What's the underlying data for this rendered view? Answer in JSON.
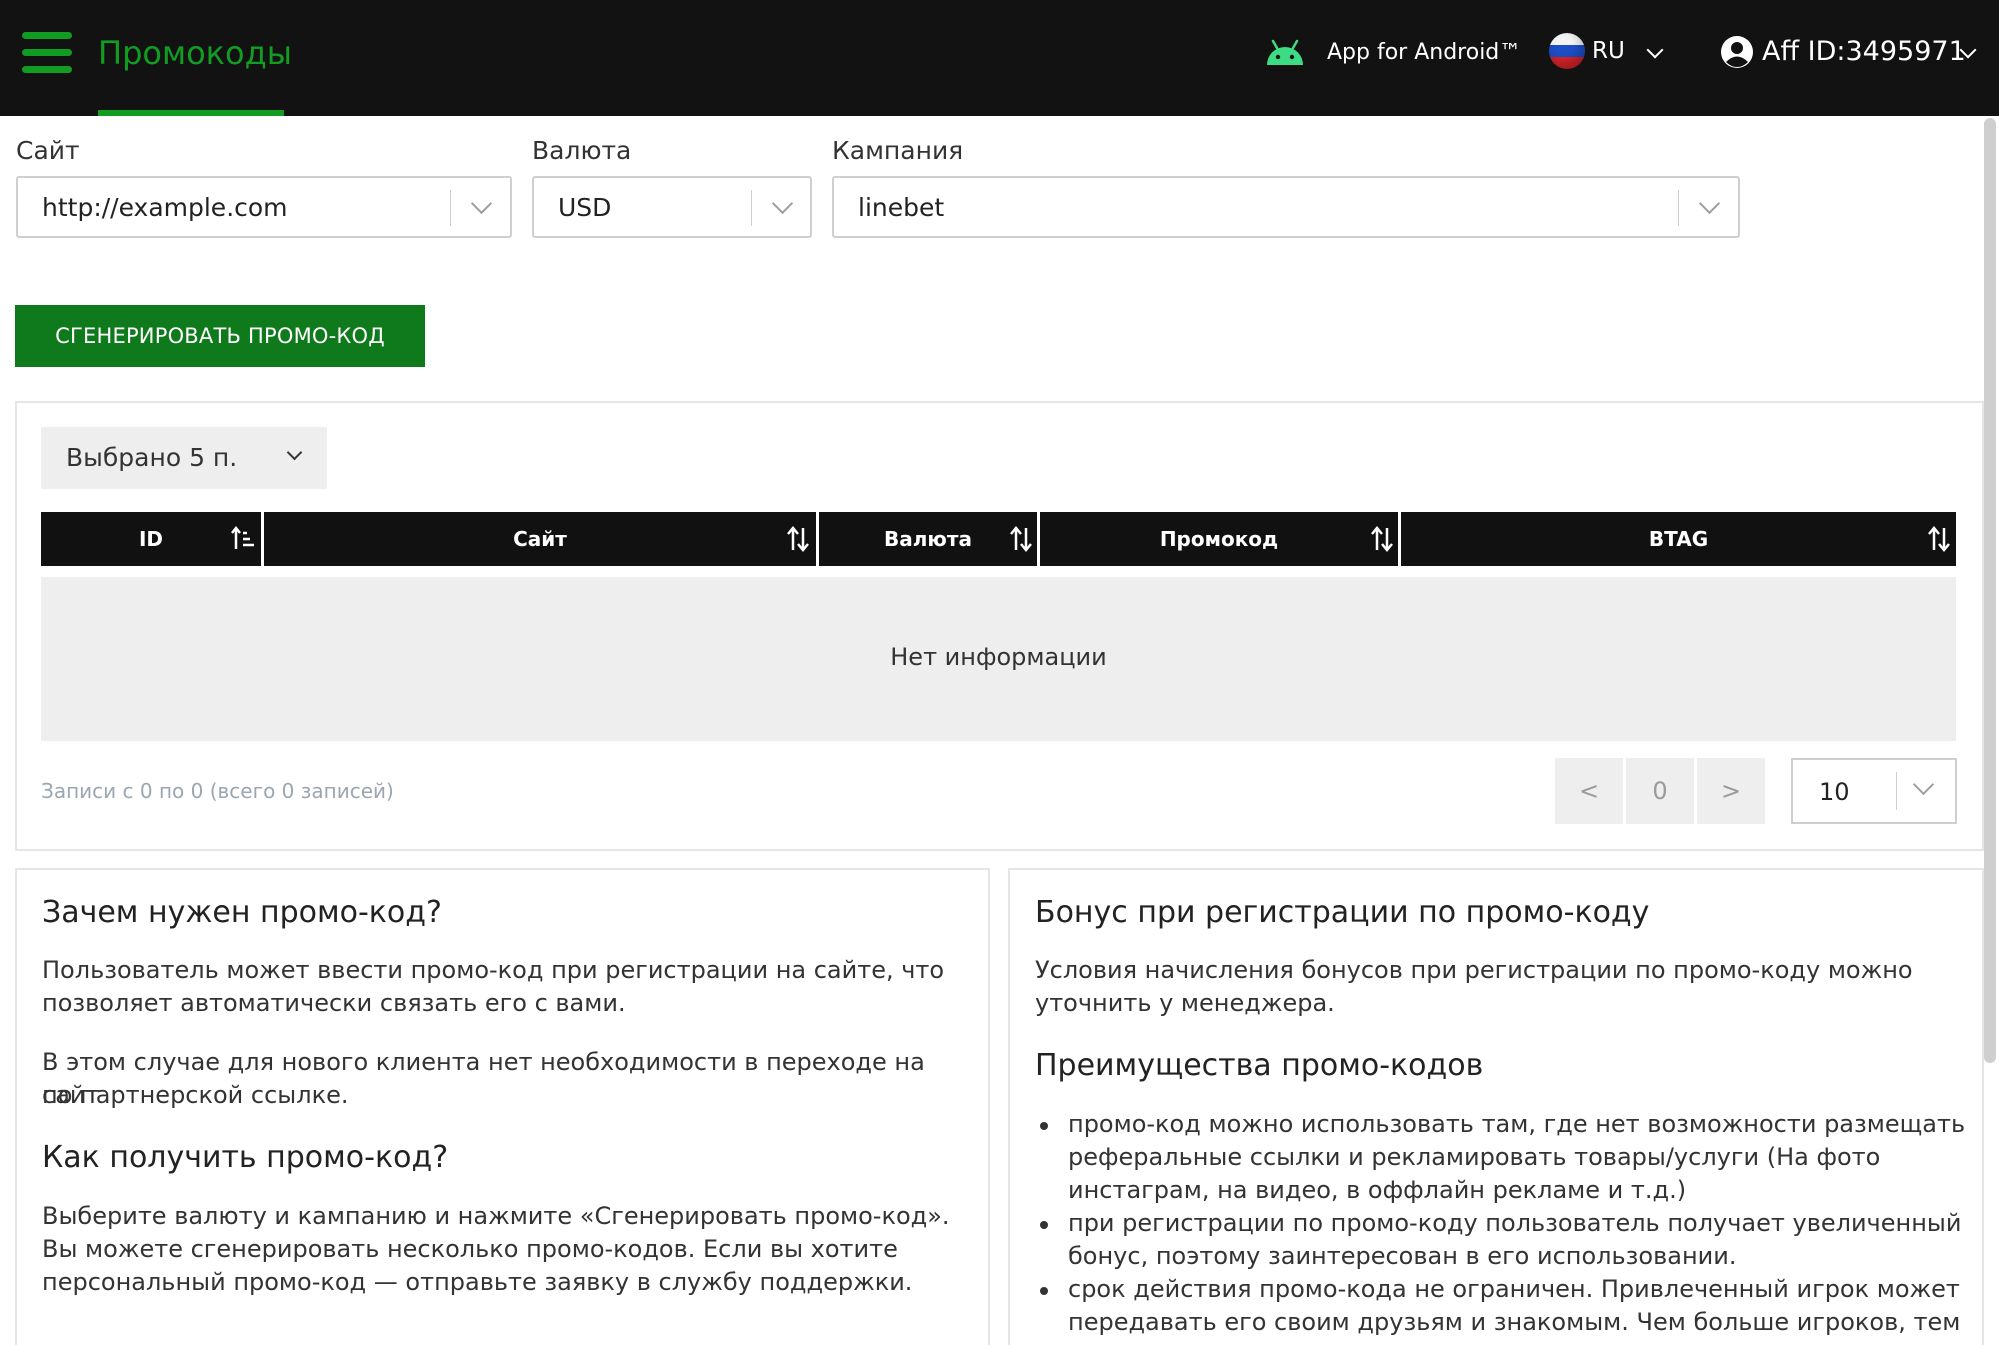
{
  "header": {
    "title": "Промокоды",
    "app_label": "App for Android™",
    "language": "RU",
    "aff_id": "Aff ID:3495971"
  },
  "filters": {
    "site": {
      "label": "Сайт",
      "value": "http://example.com"
    },
    "currency": {
      "label": "Валюта",
      "value": "USD"
    },
    "campaign": {
      "label": "Кампания",
      "value": "linebet"
    }
  },
  "generate_button": "СГЕНЕРИРОВАТЬ ПРОМО-КОД",
  "table": {
    "selected_columns": "Выбрано 5 п.",
    "columns": [
      "ID",
      "Сайт",
      "Валюта",
      "Промокод",
      "BTAG"
    ],
    "empty_text": "Нет информации",
    "records_text": "Записи с 0 по 0 (всего 0 записей)",
    "pagination": {
      "prev": "<",
      "page": "0",
      "next": ">"
    },
    "per_page": "10"
  },
  "info_left": {
    "heading1": "Зачем нужен промо-код?",
    "para1_line1": "Пользователь может ввести промо-код при регистрации на сайте, что",
    "para1_line2": "позволяет автоматически связать его с вами.",
    "para2_line1": "В этом случае для нового клиента нет необходимости в переходе на сайт",
    "para2_line2": "по партнерской ссылке.",
    "heading2": "Как получить промо-код?",
    "para3_line1": "Выберите валюту и кампанию и нажмите «Сгенерировать промо-код».",
    "para3_line2": "Вы можете сгенерировать несколько промо-кодов. Если вы хотите",
    "para3_line3": "персональный промо-код — отправьте заявку в службу поддержки."
  },
  "info_right": {
    "heading1": "Бонус при регистрации по промо-коду",
    "para1_line1": "Условия начисления бонусов при регистрации по промо-коду можно",
    "para1_line2": "уточнить у менеджера.",
    "heading2": "Преимущества промо-кодов",
    "bullet1_line1": "промо-код можно использовать там, где нет возможности размещать",
    "bullet1_line2": "реферальные ссылки и рекламировать товары/услуги (На фото",
    "bullet1_line3": "инстаграм, на видео, в оффлайн рекламе и т.д.)",
    "bullet2_line1": "при регистрации по промо-коду пользователь получает увеличенный",
    "bullet2_line2": "бонус, поэтому заинтересован в его использовании.",
    "bullet3_line1": "срок действия промо-кода не ограничен. Привлеченный игрок может",
    "bullet3_line2": "передавать его своим друзьям и знакомым. Чем больше игроков, тем"
  },
  "colors": {
    "brand_green": "#139c22",
    "button_green": "#0f7a1c",
    "header_bg": "#121212",
    "android_green": "#3ddc84"
  },
  "icons": [
    "menu-icon",
    "android-icon",
    "russia-flag-icon",
    "user-icon",
    "chevron-down-icon",
    "sort-icon"
  ]
}
